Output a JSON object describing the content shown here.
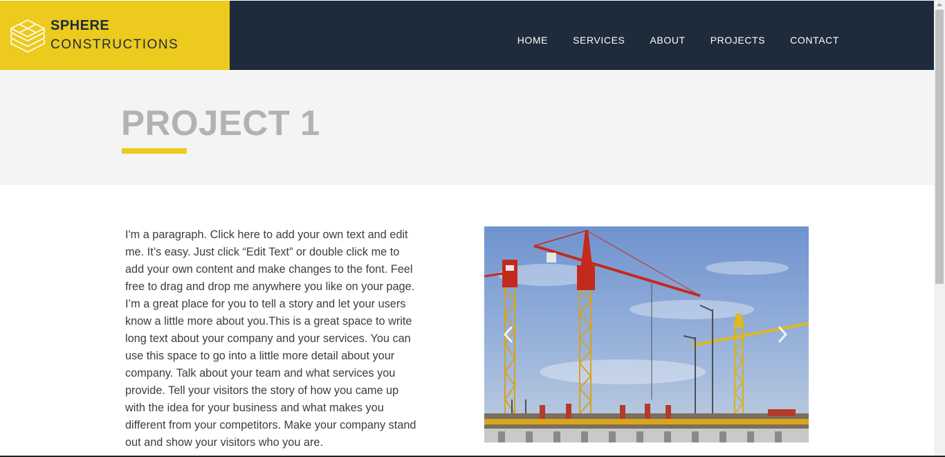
{
  "brand": {
    "line1": "SPHERE",
    "line2": "CONSTRUCTIONS",
    "icon": "layered-cubes-logo-icon",
    "accent": "#ecca1e",
    "dark": "#1e2b3a"
  },
  "nav": {
    "items": [
      {
        "label": "HOME"
      },
      {
        "label": "SERVICES"
      },
      {
        "label": "ABOUT"
      },
      {
        "label": "PROJECTS"
      },
      {
        "label": "CONTACT"
      }
    ]
  },
  "page": {
    "title": "PROJECT 1"
  },
  "content": {
    "paragraph": "I'm a paragraph. Click here to add your own text and edit me. It’s easy. Just click “Edit Text” or double click me to add your own content and make changes to the font. Feel free to drag and drop me anywhere you like on your page. I’m a great place for you to tell a story and let your users know a little more about you.This is a great space to write long text about your company and your services. You can use this space to go into a little more detail about your company. Talk about your team and what services you provide. Tell your visitors the story of how you came up with the idea for your business and what makes you different from your competitors. Make your company stand out and show your visitors who you are."
  },
  "slideshow": {
    "prev_icon": "chevron-left-icon",
    "next_icon": "chevron-right-icon"
  }
}
